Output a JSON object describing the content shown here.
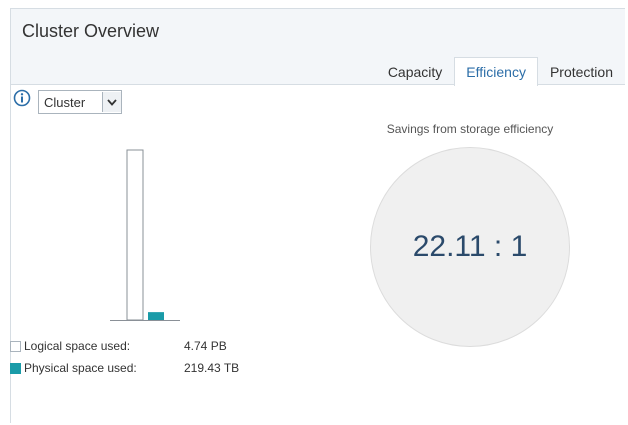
{
  "panel": {
    "title": "Cluster Overview"
  },
  "tabs": [
    {
      "label": "Capacity",
      "active": false
    },
    {
      "label": "Efficiency",
      "active": true
    },
    {
      "label": "Protection",
      "active": false
    }
  ],
  "scope_select": {
    "value": "Cluster"
  },
  "icons": {
    "info": "info-icon",
    "dropdown": "chevron-down-icon"
  },
  "chart_data": {
    "type": "bar",
    "categories": [
      "Logical space used",
      "Physical space used"
    ],
    "values_tb": [
      4740,
      219.43
    ],
    "colors": [
      "#ffffff",
      "#1a9ba8"
    ]
  },
  "legend": [
    {
      "label": "Logical space used:",
      "value": "4.74 PB"
    },
    {
      "label": "Physical space used:",
      "value": "219.43 TB"
    }
  ],
  "efficiency": {
    "label": "Savings from storage efficiency",
    "ratio": "22.11 : 1"
  },
  "colors": {
    "accent": "#2c6ea8",
    "physical": "#1a9ba8",
    "ratio_text": "#2b4a6b"
  }
}
